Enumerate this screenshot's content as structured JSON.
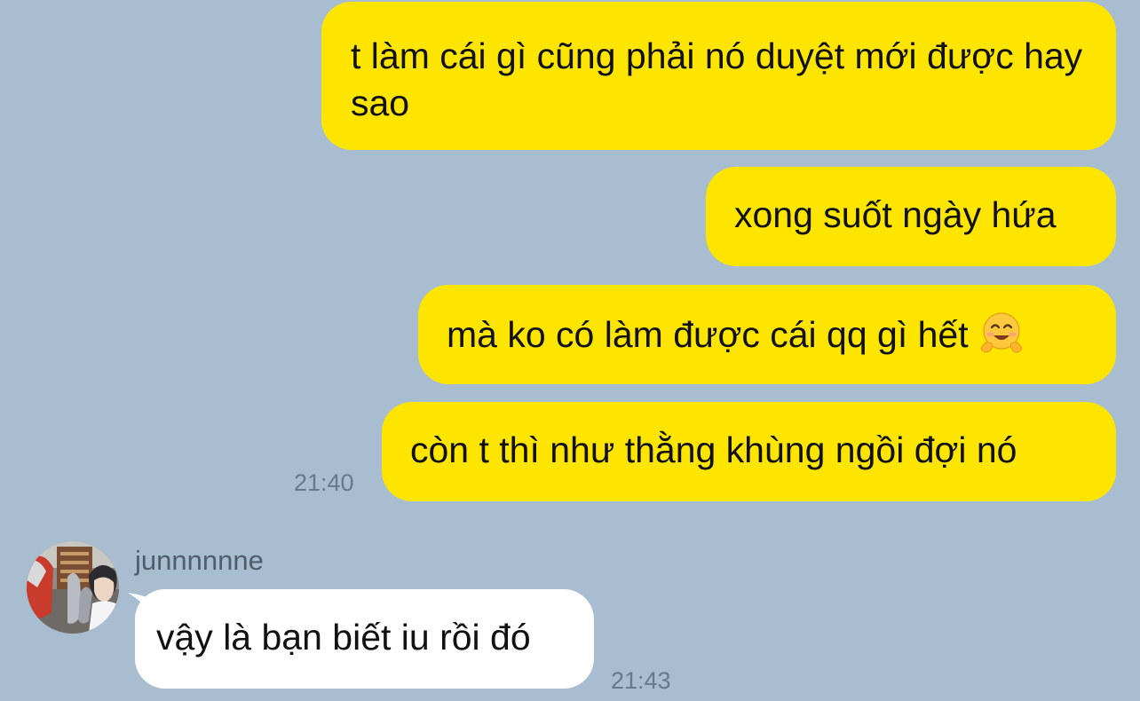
{
  "messages": [
    {
      "direction": "outgoing",
      "text": "t làm cái gì cũng phải nó duyệt mới được hay sao"
    },
    {
      "direction": "outgoing",
      "text": "xong suốt ngày hứa"
    },
    {
      "direction": "outgoing",
      "text": "mà ko có làm được cái qq gì hết",
      "emoji": "hugging-face"
    },
    {
      "direction": "outgoing",
      "text": "còn t thì như thằng khùng ngồi đợi nó",
      "time": "21:40"
    },
    {
      "direction": "incoming",
      "sender": "junnnnnne",
      "text": "vậy là bạn biết iu rồi đó",
      "time": "21:43"
    }
  ],
  "colors": {
    "background": "#A9BDD0",
    "outgoing_bubble": "#FDE500",
    "incoming_bubble": "#FFFFFF",
    "timestamp": "#667A8C",
    "sender_name": "#4E5E6E"
  }
}
